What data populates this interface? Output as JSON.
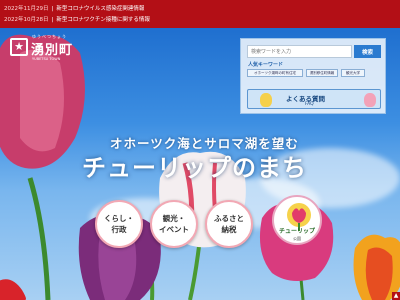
{
  "news": [
    {
      "date": "2022年11月29日",
      "title": "新型コロナウイルス感染症関連情報"
    },
    {
      "date": "2022年10月28日",
      "title": "新型コロナワクチン接種に関する情報"
    }
  ],
  "logo": {
    "ruby": "ゆうべつちょう",
    "text": "湧別町",
    "sub": "YUBETSU TOWN"
  },
  "search": {
    "placeholder": "検索ワードを入力",
    "button": "検索"
  },
  "keywords": {
    "title": "人気キーワード",
    "items": [
      "オホーツク湖畔の町有住宅",
      "湧別移住町情報",
      "観光大学"
    ]
  },
  "faq": {
    "title": "よくある質問",
    "sub": "FAQ"
  },
  "catch": {
    "line1": "オホーツク海とサロマ湖を望む",
    "line2": "チューリップのまち"
  },
  "buttons": [
    {
      "label1": "くらし・",
      "label2": "行政"
    },
    {
      "label1": "観光・",
      "label2": "イベント"
    },
    {
      "label1": "ふるさと",
      "label2": "納税"
    }
  ],
  "tulip_park": {
    "label": "チューリップ",
    "sub": "公園"
  },
  "colors": {
    "brand_red": "#b30f16",
    "sky_blue": "#3f8fd6",
    "accent_blue": "#2b7bd0"
  }
}
